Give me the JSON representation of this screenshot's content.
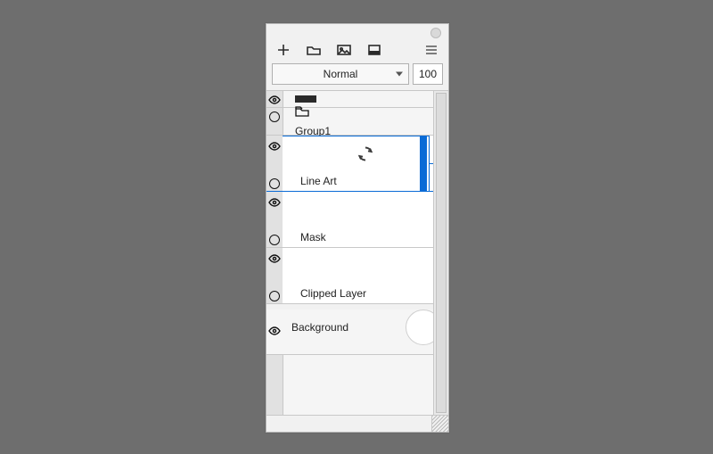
{
  "blend": {
    "mode": "Normal",
    "opacity": "100"
  },
  "layers": {
    "group": "Group1",
    "lineart": "Line Art",
    "mask": "Mask",
    "clipped": "Clipped Layer",
    "background": "Background"
  }
}
